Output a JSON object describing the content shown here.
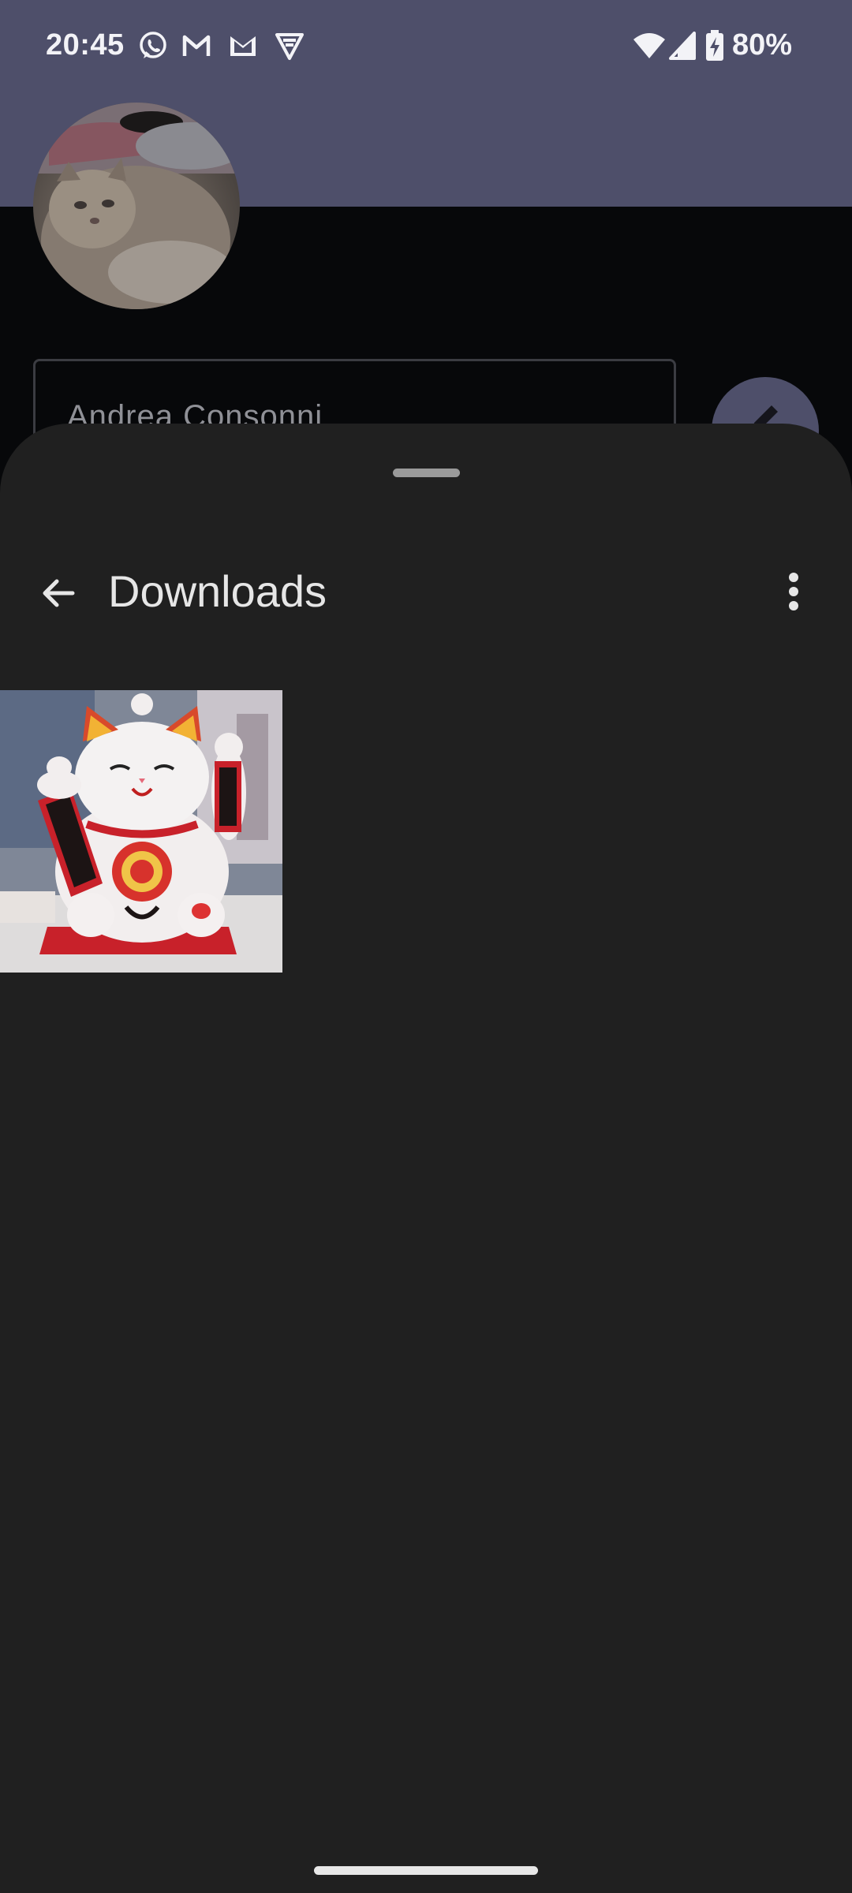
{
  "status_bar": {
    "time": "20:45",
    "notification_icons": [
      "whatsapp-icon",
      "gmail-icon",
      "gmail-icon",
      "vpn-shield-icon"
    ],
    "battery_percent": "80%"
  },
  "background": {
    "profile_name": "Andrea Consonni",
    "colors": {
      "header": "#4e4f6a",
      "page": "#07080a"
    }
  },
  "sheet": {
    "title": "Downloads",
    "items": [
      {
        "type": "image",
        "subject": "maneki-neko-figurine"
      }
    ],
    "colors": {
      "surface": "#202020",
      "text": "#e6e6e6"
    }
  }
}
